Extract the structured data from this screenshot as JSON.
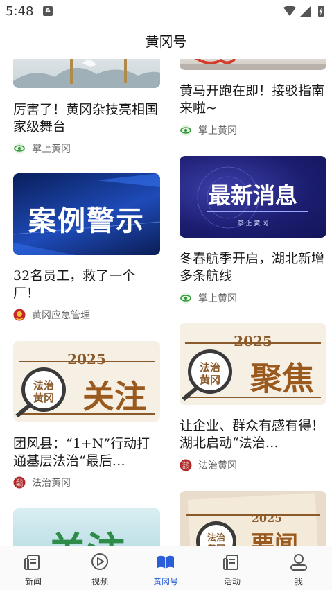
{
  "status_bar": {
    "time": "5:48",
    "notification_badge": "A"
  },
  "header": {
    "title": "黄冈号"
  },
  "feed": {
    "left": [
      {
        "title": "厉害了！黄冈杂技亮相国家级舞台",
        "source": "掌上黄冈",
        "source_icon": "eye-logo-icon"
      },
      {
        "thumb_text": "案例警示",
        "title": "32名员工，救了一个厂！",
        "source": "黄冈应急管理",
        "source_icon": "emblem-icon"
      },
      {
        "thumb_year": "2025",
        "thumb_badge_line1": "法治",
        "thumb_badge_line2": "黄冈",
        "thumb_text": "关注",
        "title": "团风县：“1+N”行动打通基层法治“最后…",
        "source": "法治黄冈",
        "source_icon": "fazhi-logo-icon"
      },
      {
        "thumb_text": "关注"
      }
    ],
    "right": [
      {
        "title": "黄马开跑在即！接驳指南来啦~",
        "source": "掌上黄冈",
        "source_icon": "eye-logo-icon"
      },
      {
        "thumb_text": "最新消息",
        "thumb_subtext": "掌 上 黄 冈",
        "title": "冬春航季开启，湖北新增多条航线",
        "source": "掌上黄冈",
        "source_icon": "eye-logo-icon"
      },
      {
        "thumb_year": "2025",
        "thumb_badge_line1": "法治",
        "thumb_badge_line2": "黄冈",
        "thumb_text": "聚焦",
        "title": "让企业、群众有感有得！湖北启动“法治…",
        "source": "法治黄冈",
        "source_icon": "fazhi-logo-icon",
        "source_icon_text": "法治\n黄冈"
      },
      {
        "thumb_year": "2025",
        "thumb_badge_line1": "法治",
        "thumb_badge_line2": "黄冈",
        "thumb_text": "要闻"
      }
    ]
  },
  "tabs": [
    {
      "label": "新闻",
      "icon": "newspaper-icon",
      "active": false
    },
    {
      "label": "视频",
      "icon": "play-circle-icon",
      "active": false
    },
    {
      "label": "黄冈号",
      "icon": "open-book-icon",
      "active": true
    },
    {
      "label": "活动",
      "icon": "activity-icon",
      "active": false
    },
    {
      "label": "我",
      "icon": "user-icon",
      "active": false
    }
  ],
  "colors": {
    "accent": "#2b5fd9",
    "fazhi_red": "#b22a2a",
    "fazhi_brown": "#8a5a2b",
    "case_blue": "#0d2a7a"
  }
}
